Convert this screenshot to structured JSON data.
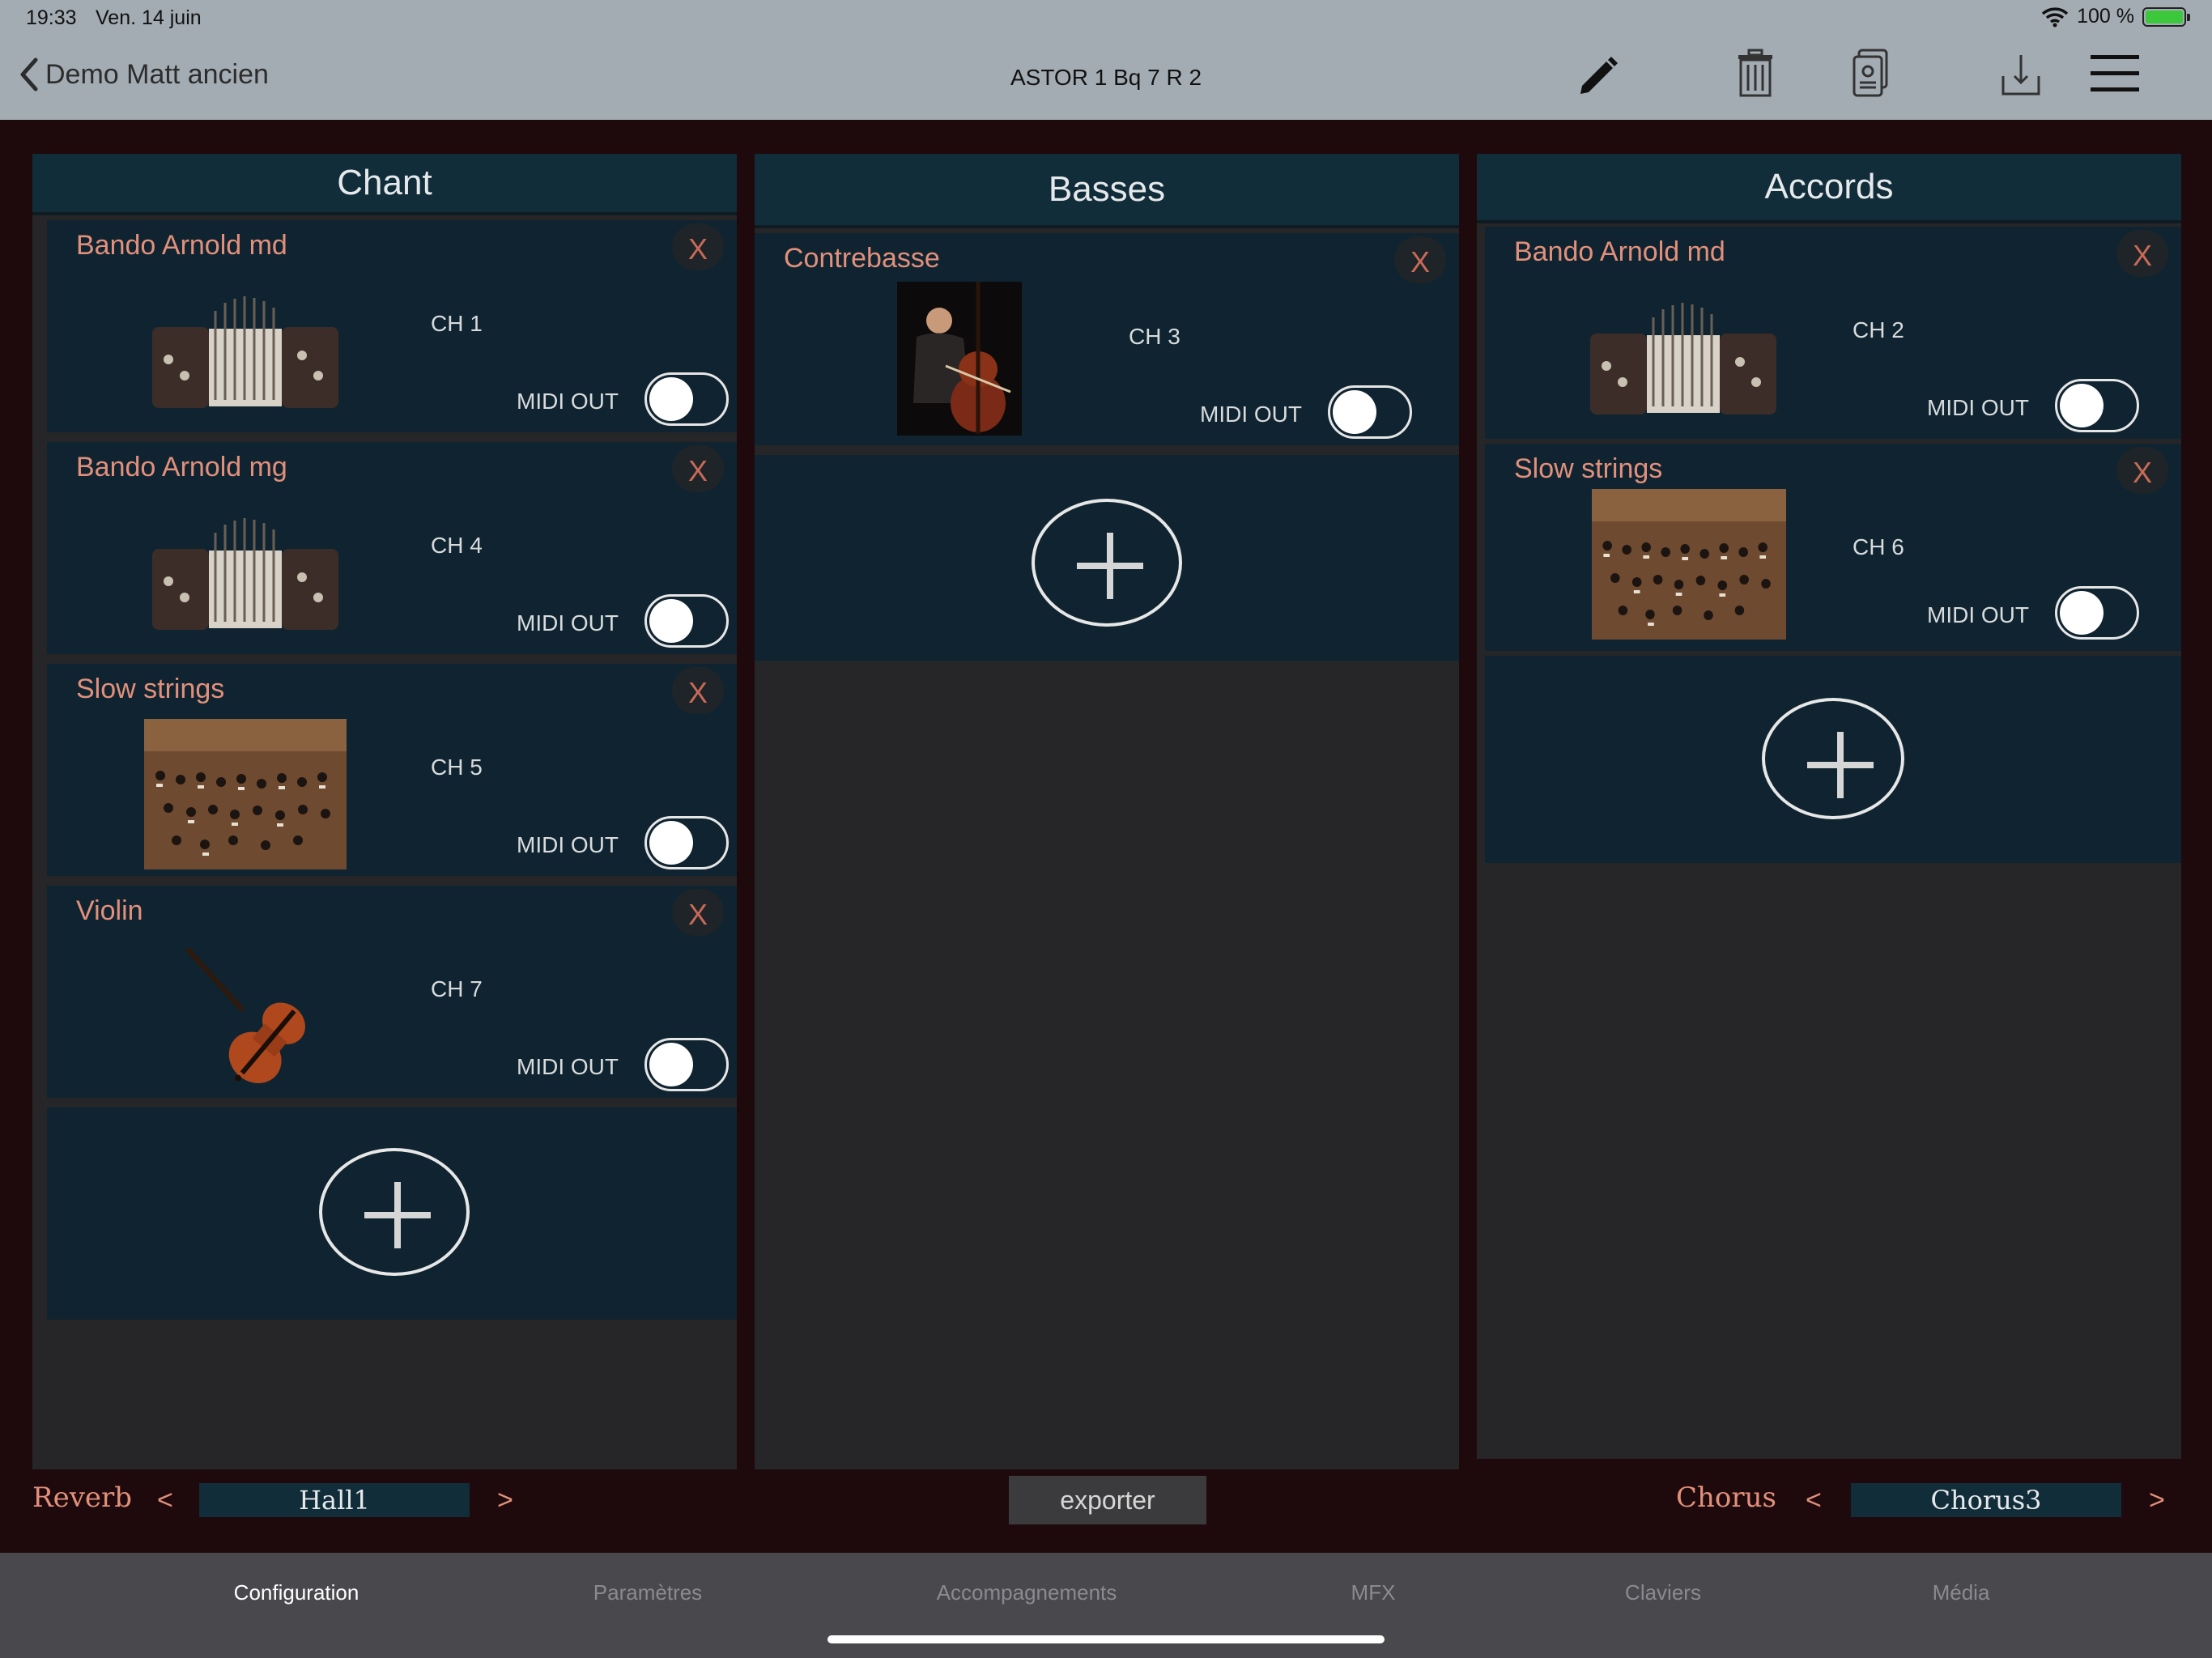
{
  "status": {
    "time": "19:33",
    "date": "Ven. 14 juin",
    "battery": "100 %"
  },
  "nav": {
    "back_label": "Demo Matt ancien",
    "title": "ASTOR 1 Bq 7 R 2"
  },
  "columns": [
    {
      "title": "Chant",
      "cards": [
        {
          "name": "Bando Arnold md",
          "channel": "CH 1",
          "midi_label": "MIDI OUT",
          "midi_out": false,
          "image": "bandoneon-image"
        },
        {
          "name": "Bando Arnold mg",
          "channel": "CH 4",
          "midi_label": "MIDI OUT",
          "midi_out": false,
          "image": "bandoneon-image"
        },
        {
          "name": "Slow strings",
          "channel": "CH 5",
          "midi_label": "MIDI OUT",
          "midi_out": false,
          "image": "orchestra-image"
        },
        {
          "name": "Violin",
          "channel": "CH 7",
          "midi_label": "MIDI OUT",
          "midi_out": false,
          "image": "violin-image"
        }
      ]
    },
    {
      "title": "Basses",
      "cards": [
        {
          "name": "Contrebasse",
          "channel": "CH 3",
          "midi_label": "MIDI OUT",
          "midi_out": false,
          "image": "double-bass-image"
        }
      ]
    },
    {
      "title": "Accords",
      "cards": [
        {
          "name": "Bando Arnold md",
          "channel": "CH 2",
          "midi_label": "MIDI OUT",
          "midi_out": false,
          "image": "bandoneon-image"
        },
        {
          "name": "Slow strings",
          "channel": "CH 6",
          "midi_label": "MIDI OUT",
          "midi_out": false,
          "image": "orchestra-image"
        }
      ]
    }
  ],
  "remove_label": "X",
  "effects": {
    "reverb": {
      "label": "Reverb",
      "value": "Hall1",
      "prev": "<",
      "next": ">"
    },
    "chorus": {
      "label": "Chorus",
      "value": "Chorus3",
      "prev": "<",
      "next": ">"
    },
    "export_label": "exporter"
  },
  "tabs": [
    {
      "label": "Configuration",
      "active": true
    },
    {
      "label": "Paramètres",
      "active": false
    },
    {
      "label": "Accompagnements",
      "active": false
    },
    {
      "label": "MFX",
      "active": false
    },
    {
      "label": "Claviers",
      "active": false
    },
    {
      "label": "Média",
      "active": false
    }
  ],
  "colors": {
    "accent": "#e2907b",
    "header": "#112d3a",
    "card": "#0f2430",
    "background": "#1e0a0c",
    "topbar": "#a3acb3"
  }
}
